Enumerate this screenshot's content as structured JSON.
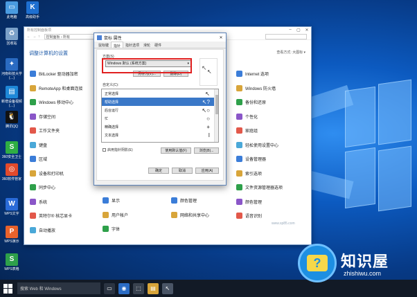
{
  "desktop_icons": [
    {
      "id": "computer",
      "label": "此电脑",
      "color": "#4a9be0",
      "glyph": "▭"
    },
    {
      "id": "kuaijian",
      "label": "高级助手",
      "color": "#1e6fd0",
      "glyph": "K"
    },
    {
      "id": "recycle",
      "label": "回收站",
      "color": "#7aa0c8",
      "glyph": "♻"
    },
    {
      "id": "hebei",
      "label": "河南科技大学(…)",
      "color": "#2a6bc2",
      "glyph": "✦"
    },
    {
      "id": "video",
      "label": "新增设备视频(…)",
      "color": "#1e88d8",
      "glyph": "▤"
    },
    {
      "id": "qq",
      "label": "腾讯QQ",
      "color": "#111111",
      "glyph": "🐧"
    },
    {
      "id": "360safe",
      "label": "360安全卫士",
      "color": "#2fae44",
      "glyph": "S"
    },
    {
      "id": "360soft",
      "label": "360软件管家",
      "color": "#e24a2c",
      "glyph": "◎"
    },
    {
      "id": "wpsw",
      "label": "WPS文字",
      "color": "#2a6bd8",
      "glyph": "W"
    },
    {
      "id": "wpsp",
      "label": "WPS演示",
      "color": "#e8622c",
      "glyph": "P"
    },
    {
      "id": "wpss",
      "label": "WPS表格",
      "color": "#2ea04a",
      "glyph": "S"
    }
  ],
  "control_panel": {
    "title": "所有控制面板项",
    "address": "控制面板 › 所有",
    "heading": "调整计算机的设置",
    "view_by": "查看方式: 大图标 ▾",
    "left_items": [
      "BitLocker 驱动器加密",
      "RemoteApp 和桌面连接",
      "Windows 移动中心",
      "存储空间",
      "工作文件夹",
      "键盘",
      "区域",
      "设备和打印机",
      "同步中心",
      "系统",
      "英特尔® 核芯显卡",
      "自动播放"
    ],
    "mid_items": [
      "显示",
      "用户帐户",
      "字体"
    ],
    "right_items": [
      "Internet 选项",
      "Windows 防火墙",
      "备份和还原",
      "个性化",
      "家庭组",
      "轻松使用设置中心",
      "设备管理器",
      "索引选项",
      "文件资源管理器选项",
      "颜色管理",
      "语音识别"
    ],
    "mid2_items": [
      "颜色管理",
      "网络和共享中心"
    ]
  },
  "mouse_dialog": {
    "title": "鼠标 属性",
    "close": "✕",
    "tabs": [
      "鼠标键",
      "指针",
      "指针选项",
      "滑轮",
      "硬件"
    ],
    "scheme_label": "方案(S)",
    "scheme_value": "Windows 默认 (系统方案)",
    "save_as": "另存为(V)...",
    "delete": "删除(D)",
    "customize_label": "自定义(C):",
    "cursors": [
      {
        "name": "正常选择",
        "glyph": "↖"
      },
      {
        "name": "帮助选择",
        "glyph": "↖?"
      },
      {
        "name": "后台运行",
        "glyph": "↖○"
      },
      {
        "name": "忙",
        "glyph": "○"
      },
      {
        "name": "精确选择",
        "glyph": "+"
      },
      {
        "name": "文本选择",
        "glyph": "I"
      }
    ],
    "selected_index": 1,
    "shadow_label": "启用指针阴影(E)",
    "use_default": "使用默认值(F)",
    "browse": "浏览(B)...",
    "ok": "确定",
    "cancel": "取消",
    "apply": "应用(A)"
  },
  "taskbar": {
    "search_placeholder": "搜索 Web 和 Windows"
  },
  "watermark": {
    "cn": "知识屋",
    "en": "zhishiwu.com",
    "site": "www.xp85.com"
  }
}
